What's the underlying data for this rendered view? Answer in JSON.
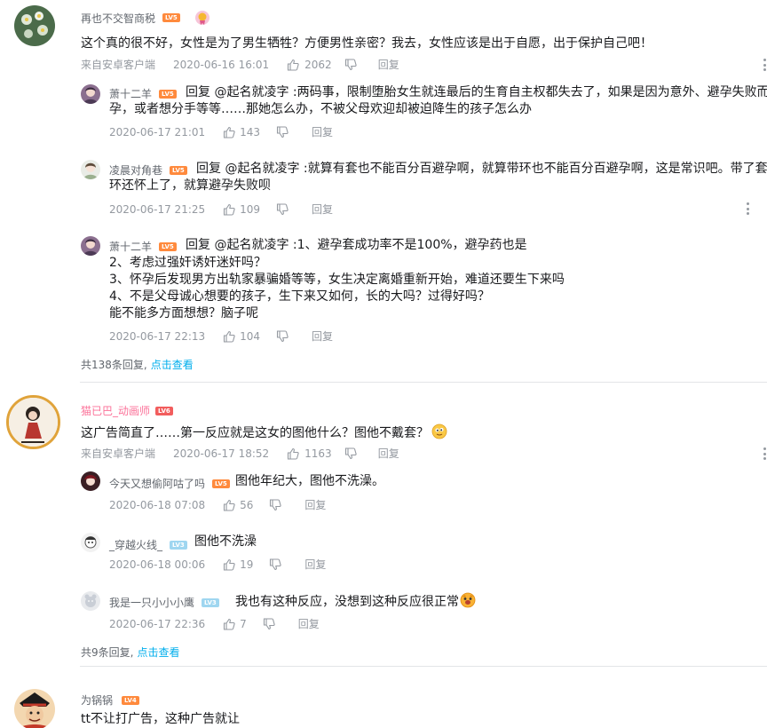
{
  "comments": [
    {
      "user": "再也不交智商税",
      "level": "LV5",
      "text": "这个真的很不好，女性是为了男生牺牲？方便男性亲密？我去，女性应该是出于自愿，出于保护自己吧！",
      "source": "来自安卓客户端",
      "time": "2020-06-16 16:01",
      "likes": "2062",
      "reply_label": "回复",
      "replies": [
        {
          "user": "萧十二羊",
          "level": "LV5",
          "lines": [
            "回复 @起名就凌字 :两码事，限制堕胎女生就连最后的生育自主权都失去了，如果是因为意外、避孕失败而怀",
            "孕，或者想分手等等……那她怎么办，不被父母欢迎却被迫降生的孩子怎么办"
          ],
          "time": "2020-06-17 21:01",
          "likes": "143",
          "reply_label": "回复"
        },
        {
          "user": "凌晨对角巷",
          "level": "LV5",
          "lines": [
            "回复 @起名就凌字 :就算有套也不能百分百避孕啊，就算带环也不能百分百避孕啊，这是常识吧。带了套带了",
            "环还怀上了，就算避孕失败呗"
          ],
          "time": "2020-06-17 21:25",
          "likes": "109",
          "reply_label": "回复"
        },
        {
          "user": "萧十二羊",
          "level": "LV5",
          "lines": [
            "回复 @起名就凌字 :1、避孕套成功率不是100%，避孕药也是",
            "2、考虑过强奸诱奸迷奸吗？",
            "3、怀孕后发现男方出轨家暴骗婚等等，女生决定离婚重新开始，难道还要生下来吗",
            "4、不是父母诚心想要的孩子，生下来又如何，长的大吗？过得好吗？",
            "能不能多方面想想？脑子呢"
          ],
          "time": "2020-06-17 22:13",
          "likes": "104",
          "reply_label": "回复"
        }
      ],
      "total_replies": "共138条回复,",
      "view_more": "点击查看"
    },
    {
      "user": "猫已巴_动画师",
      "level": "LV6",
      "text": "这广告简直了……第一反应就是这女的图他什么？图他不戴套？",
      "source": "来自安卓客户端",
      "time": "2020-06-17 18:52",
      "likes": "1163",
      "reply_label": "回复",
      "replies": [
        {
          "user": "今天又想偷阿咕了吗",
          "level": "LV5",
          "lines": [
            "图他年纪大，图他不洗澡。"
          ],
          "time": "2020-06-18 07:08",
          "likes": "56",
          "reply_label": "回复"
        },
        {
          "user": "_穿越火线_",
          "level": "LV3",
          "lines": [
            "图他不洗澡"
          ],
          "time": "2020-06-18 00:06",
          "likes": "19",
          "reply_label": "回复"
        },
        {
          "user": "我是一只小小小鹰",
          "level": "LV3",
          "lines": [
            "我也有这种反应，没想到这种反应很正常"
          ],
          "time": "2020-06-17 22:36",
          "likes": "7",
          "reply_label": "回复"
        }
      ],
      "total_replies": "共9条回复,",
      "view_more": "点击查看"
    },
    {
      "user": "为锅锅",
      "level": "LV4",
      "text": "tt不让打广告，这种广告就让"
    }
  ],
  "colors": {
    "link": "#00aeec",
    "vip_name": "#fb7299",
    "level": "#ff8a3d"
  },
  "icons": [
    "thumb-up-icon",
    "thumb-down-icon",
    "more-icon",
    "medal-icon",
    "emoji-icon"
  ]
}
